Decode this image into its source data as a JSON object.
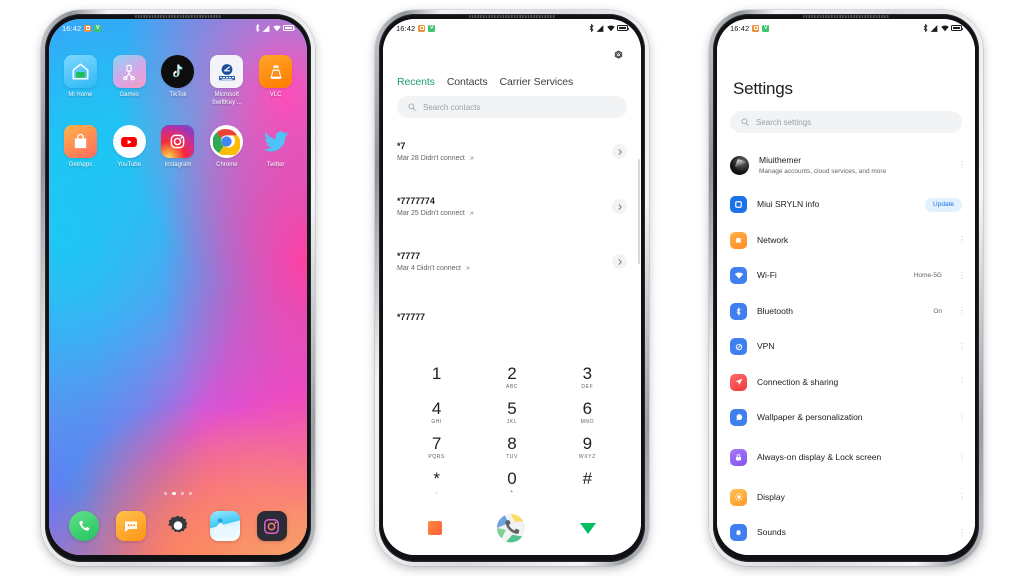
{
  "theme": {
    "accent_green": "#1a9e6a",
    "accent_blue": "#1a73e8",
    "text_primary": "#202124",
    "text_secondary": "#5f6368",
    "chip_bg": "#f1f3f4"
  },
  "status_bar": {
    "time": "16:42",
    "left_icons": [
      "notification-orange-icon",
      "vpn-green-icon"
    ],
    "right_icons": [
      "bluetooth-icon",
      "signal-icon",
      "wifi-icon",
      "battery-icon"
    ]
  },
  "phone1": {
    "name": "home-screen",
    "wallpaper": "gradient-blue-magenta-orange",
    "apps": [
      {
        "label": "Mi Home",
        "icon": "mi-home-icon"
      },
      {
        "label": "Games",
        "icon": "games-icon"
      },
      {
        "label": "TikTok",
        "icon": "tiktok-icon"
      },
      {
        "label": "Microsoft\nSwiftKey ...",
        "icon": "swiftkey-icon"
      },
      {
        "label": "VLC",
        "icon": "vlc-icon"
      },
      {
        "label": "GetApps",
        "icon": "getapps-icon"
      },
      {
        "label": "YouTube",
        "icon": "youtube-icon"
      },
      {
        "label": "Instagram",
        "icon": "instagram-icon"
      },
      {
        "label": "Chrome",
        "icon": "chrome-icon"
      },
      {
        "label": "Twitter",
        "icon": "twitter-icon"
      }
    ],
    "page_dots": {
      "count": 4,
      "active_index": 1
    },
    "dock": [
      {
        "label": "Phone",
        "icon": "phone-icon"
      },
      {
        "label": "Messages",
        "icon": "messages-icon"
      },
      {
        "label": "Settings",
        "icon": "settings-gear-icon"
      },
      {
        "label": "Gallery",
        "icon": "gallery-icon"
      },
      {
        "label": "Camera",
        "icon": "camera-icon"
      }
    ]
  },
  "phone2": {
    "name": "dialer-app",
    "settings_icon": "gear-icon",
    "tabs": [
      {
        "label": "Recents",
        "active": true
      },
      {
        "label": "Contacts",
        "active": false
      },
      {
        "label": "Carrier Services",
        "active": false
      }
    ],
    "search": {
      "placeholder": "Search contacts",
      "icon": "search-icon"
    },
    "calls": [
      {
        "number": "*7",
        "detail": "Mar 28 Didn't connect",
        "direction": "outgoing-arrow-icon"
      },
      {
        "number": "*7777774",
        "detail": "Mar 25 Didn't connect",
        "direction": "outgoing-arrow-icon"
      },
      {
        "number": "*7777",
        "detail": "Mar 4 Didn't connect",
        "direction": "outgoing-arrow-icon"
      },
      {
        "number": "*77777",
        "detail": "",
        "direction": "outgoing-arrow-icon"
      }
    ],
    "keypad": [
      {
        "digit": "1",
        "letters": ""
      },
      {
        "digit": "2",
        "letters": "ABC"
      },
      {
        "digit": "3",
        "letters": "DEF"
      },
      {
        "digit": "4",
        "letters": "GHI"
      },
      {
        "digit": "5",
        "letters": "JKL"
      },
      {
        "digit": "6",
        "letters": "MNO"
      },
      {
        "digit": "7",
        "letters": "PQRS"
      },
      {
        "digit": "8",
        "letters": "TUV"
      },
      {
        "digit": "9",
        "letters": "WXYZ"
      },
      {
        "digit": "*",
        "letters": ","
      },
      {
        "digit": "0",
        "letters": "+"
      },
      {
        "digit": "#",
        "letters": ""
      }
    ],
    "actions": [
      {
        "name": "video-call-button",
        "icon": "orange-square-icon"
      },
      {
        "name": "call-button",
        "icon": "call-fab-icon"
      },
      {
        "name": "hide-keypad-button",
        "icon": "chevron-down-icon"
      }
    ]
  },
  "phone3": {
    "name": "settings-app",
    "title": "Settings",
    "search": {
      "placeholder": "Search settings",
      "icon": "search-icon"
    },
    "items": [
      {
        "name": "Miuithemer",
        "desc": "Manage accounts, cloud services, and more",
        "value": "",
        "badge": "",
        "icon": "account-avatar",
        "more": "⋮"
      },
      {
        "name": "Miui SRYLN info",
        "desc": "",
        "value": "",
        "badge": "Update",
        "icon": "miui-info-icon",
        "more": ""
      },
      {
        "name": "Network",
        "desc": "",
        "value": "",
        "badge": "",
        "icon": "network-icon",
        "more": "⋮"
      },
      {
        "name": "Wi-Fi",
        "desc": "",
        "value": "Home-5G",
        "badge": "",
        "icon": "wifi-icon",
        "more": "⋮"
      },
      {
        "name": "Bluetooth",
        "desc": "",
        "value": "On",
        "badge": "",
        "icon": "bluetooth-icon",
        "more": "⋮"
      },
      {
        "name": "VPN",
        "desc": "",
        "value": "",
        "badge": "",
        "icon": "vpn-icon",
        "more": "⋮"
      },
      {
        "name": "Connection & sharing",
        "desc": "",
        "value": "",
        "badge": "",
        "icon": "connection-sharing-icon",
        "more": "⋮"
      },
      {
        "name": "Wallpaper & personalization",
        "desc": "",
        "value": "",
        "badge": "",
        "icon": "wallpaper-icon",
        "more": "⋮"
      },
      {
        "name": "Always-on display & Lock screen",
        "desc": "",
        "value": "",
        "badge": "",
        "icon": "lockscreen-icon",
        "more": "⋮"
      },
      {
        "name": "Display",
        "desc": "",
        "value": "",
        "badge": "",
        "icon": "display-icon",
        "more": "⋮"
      },
      {
        "name": "Sounds",
        "desc": "",
        "value": "",
        "badge": "",
        "icon": "sounds-icon",
        "more": "⋮"
      }
    ]
  }
}
